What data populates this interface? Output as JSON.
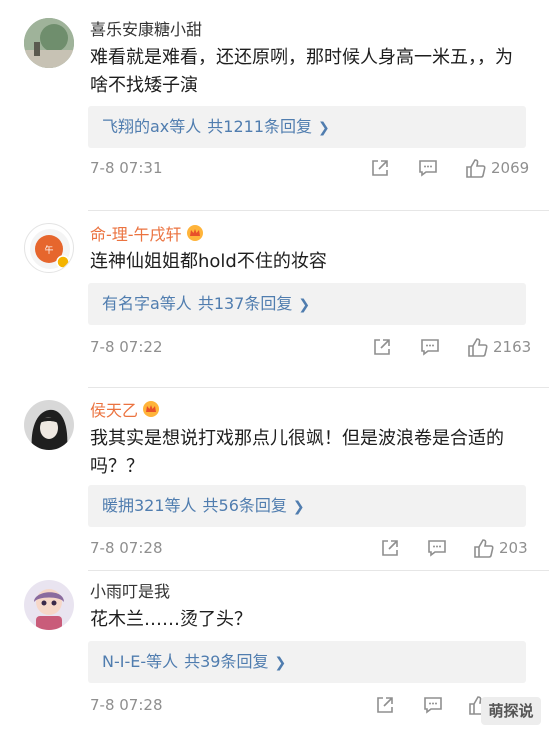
{
  "comments": [
    {
      "username": "喜乐安康糖小甜",
      "text": "难看就是难看，还还原咧，那时候人身高一米五，，为啥不找矮子演",
      "replies": {
        "users": "飞翔的ax等人",
        "count": "共1211条回复"
      },
      "time": "7-8 07:31",
      "likes": "2069"
    },
    {
      "username": "命-理-午戌轩",
      "text": "连神仙姐姐都hold不住的妆容",
      "replies": {
        "users": "有名字a等人",
        "count": "共137条回复"
      },
      "time": "7-8 07:22",
      "likes": "2163"
    },
    {
      "username": "侯天乙",
      "text": "我其实是想说打戏那点儿很飒！但是波浪卷是合适的吗？？",
      "replies": {
        "users": "暖拥321等人",
        "count": "共56条回复"
      },
      "time": "7-8 07:28",
      "likes": "203"
    },
    {
      "username": "小雨叮是我",
      "text": "花木兰……烫了头？",
      "replies": {
        "users": "N-I-E-等人",
        "count": "共39条回复"
      },
      "time": "7-8 07:28",
      "likes": ""
    }
  ],
  "watermark": "萌探说",
  "colors": {
    "vip_name": "#eb7340",
    "reply_link": "#507daf",
    "meta": "#8f8f8f"
  }
}
